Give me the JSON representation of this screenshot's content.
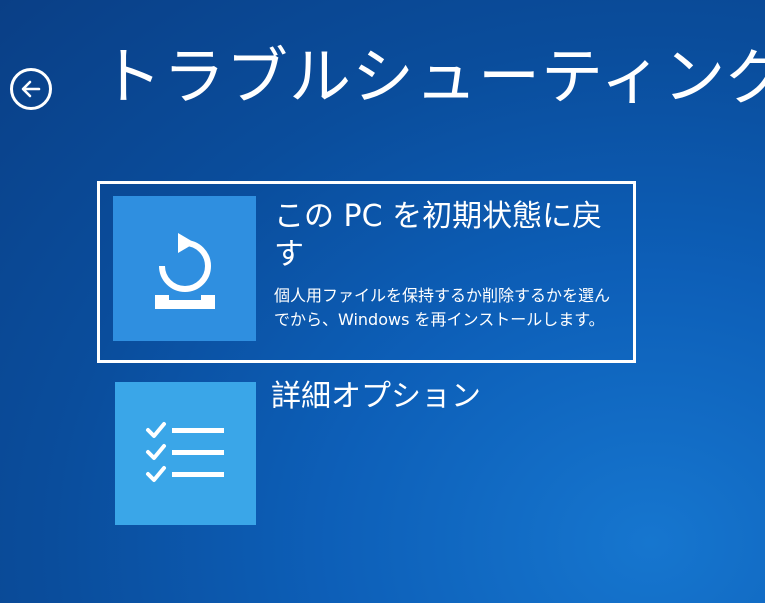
{
  "page": {
    "title": "トラブルシューティング",
    "background_color": "#0c57ad"
  },
  "back_button": {
    "icon": "arrow-left-icon"
  },
  "options": [
    {
      "title": "この PC を初期状態に戻す",
      "description": "個人用ファイルを保持するか削除するかを選んでから、Windows を再インストールします。",
      "icon": "reset-pc-icon",
      "selected": true,
      "tile_color": "#2f8fe0"
    },
    {
      "title": "詳細オプション",
      "icon": "checklist-icon",
      "selected": false,
      "tile_color": "#3aa6e8"
    }
  ]
}
